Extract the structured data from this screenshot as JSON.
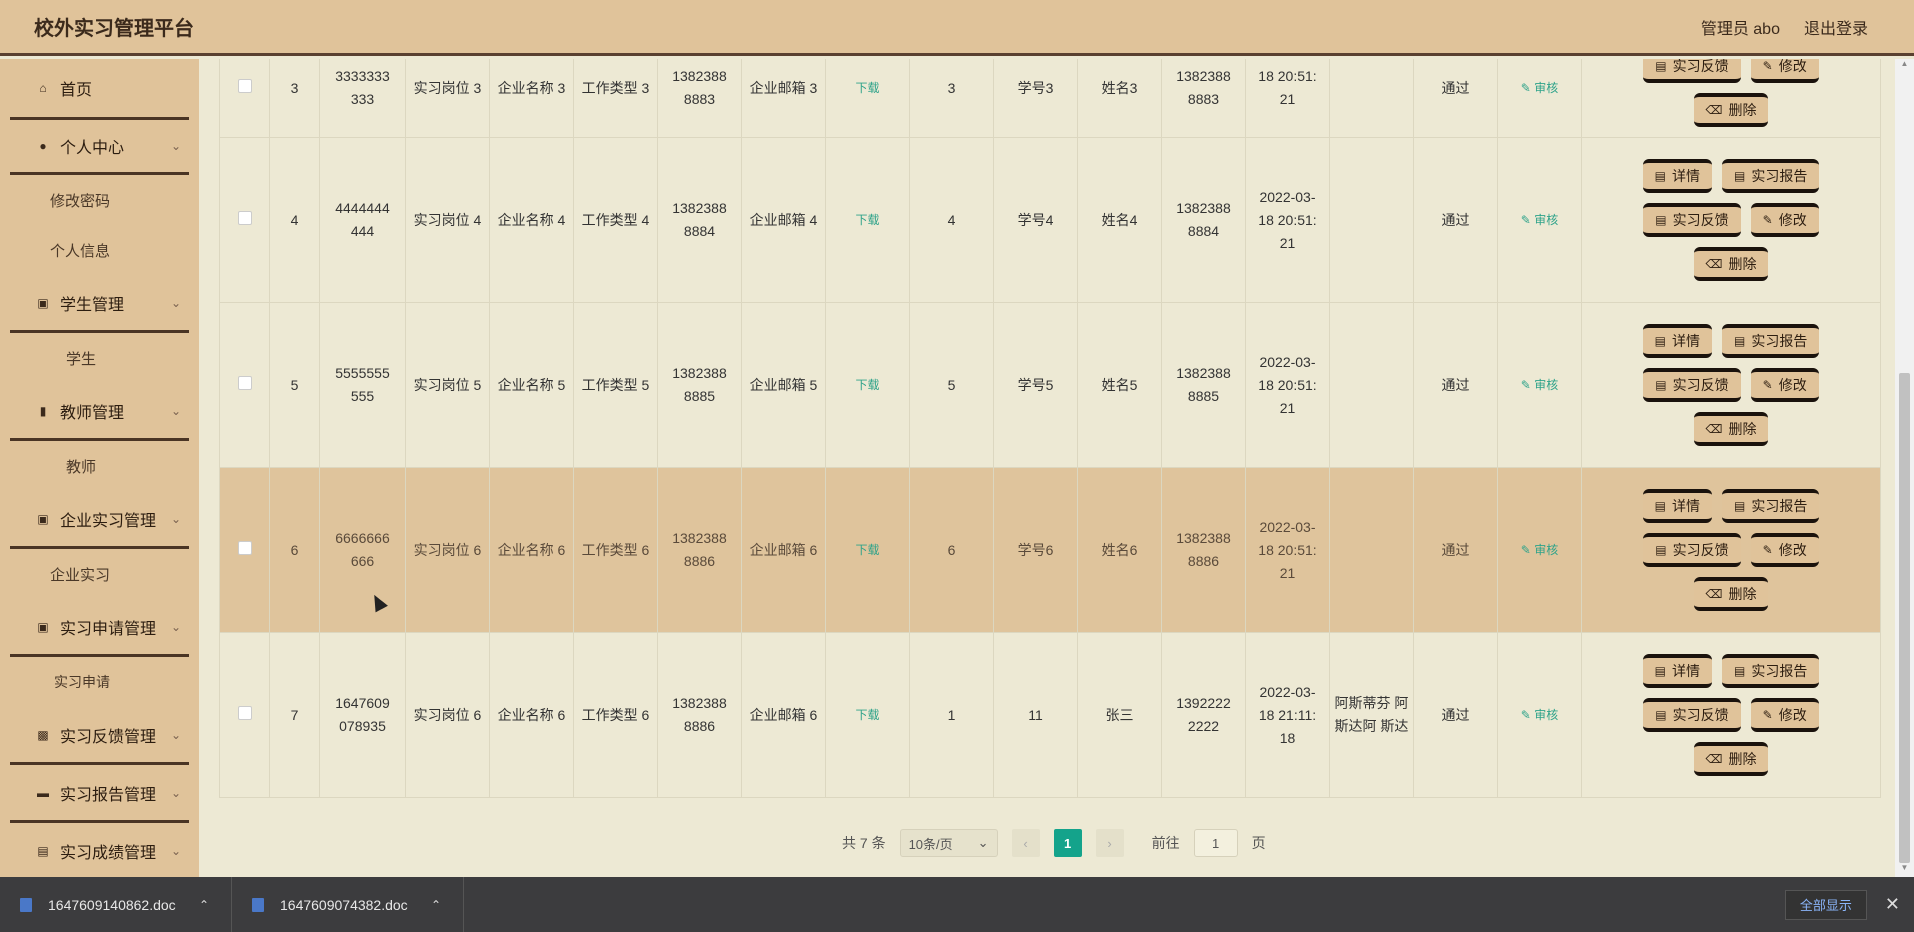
{
  "header": {
    "title": "校外实习管理平台",
    "user_label": "管理员 abo",
    "logout_label": "退出登录"
  },
  "sidebar": {
    "home": "首页",
    "personal_center": "个人中心",
    "change_password": "修改密码",
    "personal_info": "个人信息",
    "student_mgmt": "学生管理",
    "student": "学生",
    "teacher_mgmt": "教师管理",
    "teacher": "教师",
    "enterprise_mgmt": "企业实习管理",
    "enterprise": "企业实习",
    "apply_mgmt": "实习申请管理",
    "apply": "实习申请",
    "feedback_mgmt": "实习反馈管理",
    "report_mgmt": "实习报告管理",
    "score_mgmt": "实习成绩管理"
  },
  "table": {
    "download_label": "下载",
    "review_label": "审核",
    "buttons": {
      "detail": "详情",
      "report": "实习报告",
      "feedback": "实习反馈",
      "edit": "修改",
      "delete": "删除"
    },
    "rows": [
      {
        "idx": "3",
        "num": "3333333 333",
        "post": "实习岗位 3",
        "company": "企业名称 3",
        "type": "工作类型 3",
        "phone": "1382388 8883",
        "email": "企业邮箱 3",
        "n": "3",
        "sid": "学号3",
        "name": "姓名3",
        "tel": "1382388 8883",
        "time": "18 20:51: 21",
        "remark": "",
        "status": "通过"
      },
      {
        "idx": "4",
        "num": "4444444 444",
        "post": "实习岗位 4",
        "company": "企业名称 4",
        "type": "工作类型 4",
        "phone": "1382388 8884",
        "email": "企业邮箱 4",
        "n": "4",
        "sid": "学号4",
        "name": "姓名4",
        "tel": "1382388 8884",
        "time": "2022-03- 18 20:51: 21",
        "remark": "",
        "status": "通过"
      },
      {
        "idx": "5",
        "num": "5555555 555",
        "post": "实习岗位 5",
        "company": "企业名称 5",
        "type": "工作类型 5",
        "phone": "1382388 8885",
        "email": "企业邮箱 5",
        "n": "5",
        "sid": "学号5",
        "name": "姓名5",
        "tel": "1382388 8885",
        "time": "2022-03- 18 20:51: 21",
        "remark": "",
        "status": "通过"
      },
      {
        "idx": "6",
        "num": "6666666 666",
        "post": "实习岗位 6",
        "company": "企业名称 6",
        "type": "工作类型 6",
        "phone": "1382388 8886",
        "email": "企业邮箱 6",
        "n": "6",
        "sid": "学号6",
        "name": "姓名6",
        "tel": "1382388 8886",
        "time": "2022-03- 18 20:51: 21",
        "remark": "",
        "status": "通过"
      },
      {
        "idx": "7",
        "num": "1647609 078935",
        "post": "实习岗位 6",
        "company": "企业名称 6",
        "type": "工作类型 6",
        "phone": "1382388 8886",
        "email": "企业邮箱 6",
        "n": "1",
        "sid": "11",
        "name": "张三",
        "tel": "1392222 2222",
        "time": "2022-03- 18 21:11: 18",
        "remark": "阿斯蒂芬 阿斯达阿 斯达",
        "status": "通过"
      }
    ]
  },
  "pagination": {
    "total": "共 7 条",
    "page_size": "10条/页",
    "current_page": "1",
    "goto_label": "前往",
    "goto_value": "1",
    "page_suffix": "页"
  },
  "downloads": {
    "file1": "1647609140862.doc",
    "file2": "1647609074382.doc",
    "show_all": "全部显示"
  }
}
